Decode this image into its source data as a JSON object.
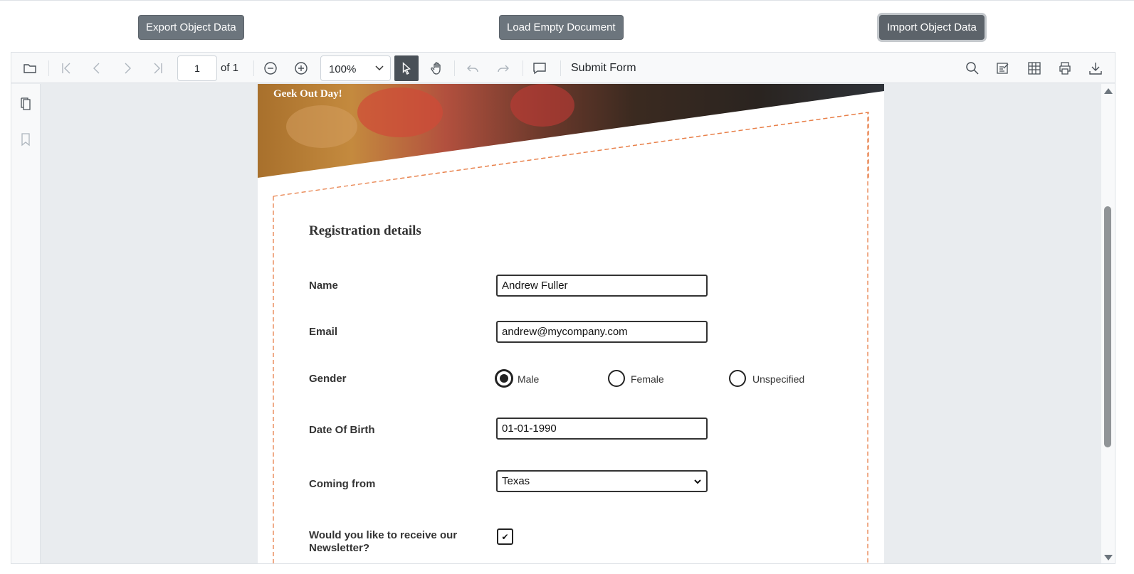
{
  "top_buttons": {
    "export": "Export Object Data",
    "load_empty": "Load Empty Document",
    "import": "Import Object Data"
  },
  "toolbar": {
    "current_page": "1",
    "page_of": "of 1",
    "zoom": "100%",
    "submit_form": "Submit Form",
    "icons": [
      "open-icon",
      "first-page-icon",
      "previous-page-icon",
      "next-page-icon",
      "last-page-icon",
      "zoom-out-icon",
      "zoom-in-icon",
      "text-select-icon",
      "pan-icon",
      "undo-icon",
      "redo-icon",
      "comment-icon",
      "search-icon",
      "annotation-icon",
      "form-fields-icon",
      "print-icon",
      "download-icon"
    ]
  },
  "sidebar": {
    "icons": [
      "page-thumbnails-icon",
      "bookmark-icon"
    ]
  },
  "document": {
    "banner_text": "Geek Out Day!",
    "form_title": "Registration details",
    "labels": {
      "name": "Name",
      "email": "Email",
      "gender": "Gender",
      "dob": "Date Of Birth",
      "coming_from": "Coming from",
      "newsletter": "Would you like to receive our Newsletter?"
    },
    "values": {
      "name": "Andrew Fuller",
      "email": "andrew@mycompany.com",
      "dob": "01-01-1990",
      "coming_from": "Texas",
      "newsletter_checked": true,
      "newsletter_mark": "✔"
    },
    "gender_options": [
      "Male",
      "Female",
      "Unspecified"
    ],
    "gender_selected": "Male"
  },
  "colors": {
    "button_bg": "#6c757d",
    "toolbar_bg": "#f8f9fa",
    "viewer_bg": "#e9ecef",
    "dashed_border": "#e8804a"
  }
}
